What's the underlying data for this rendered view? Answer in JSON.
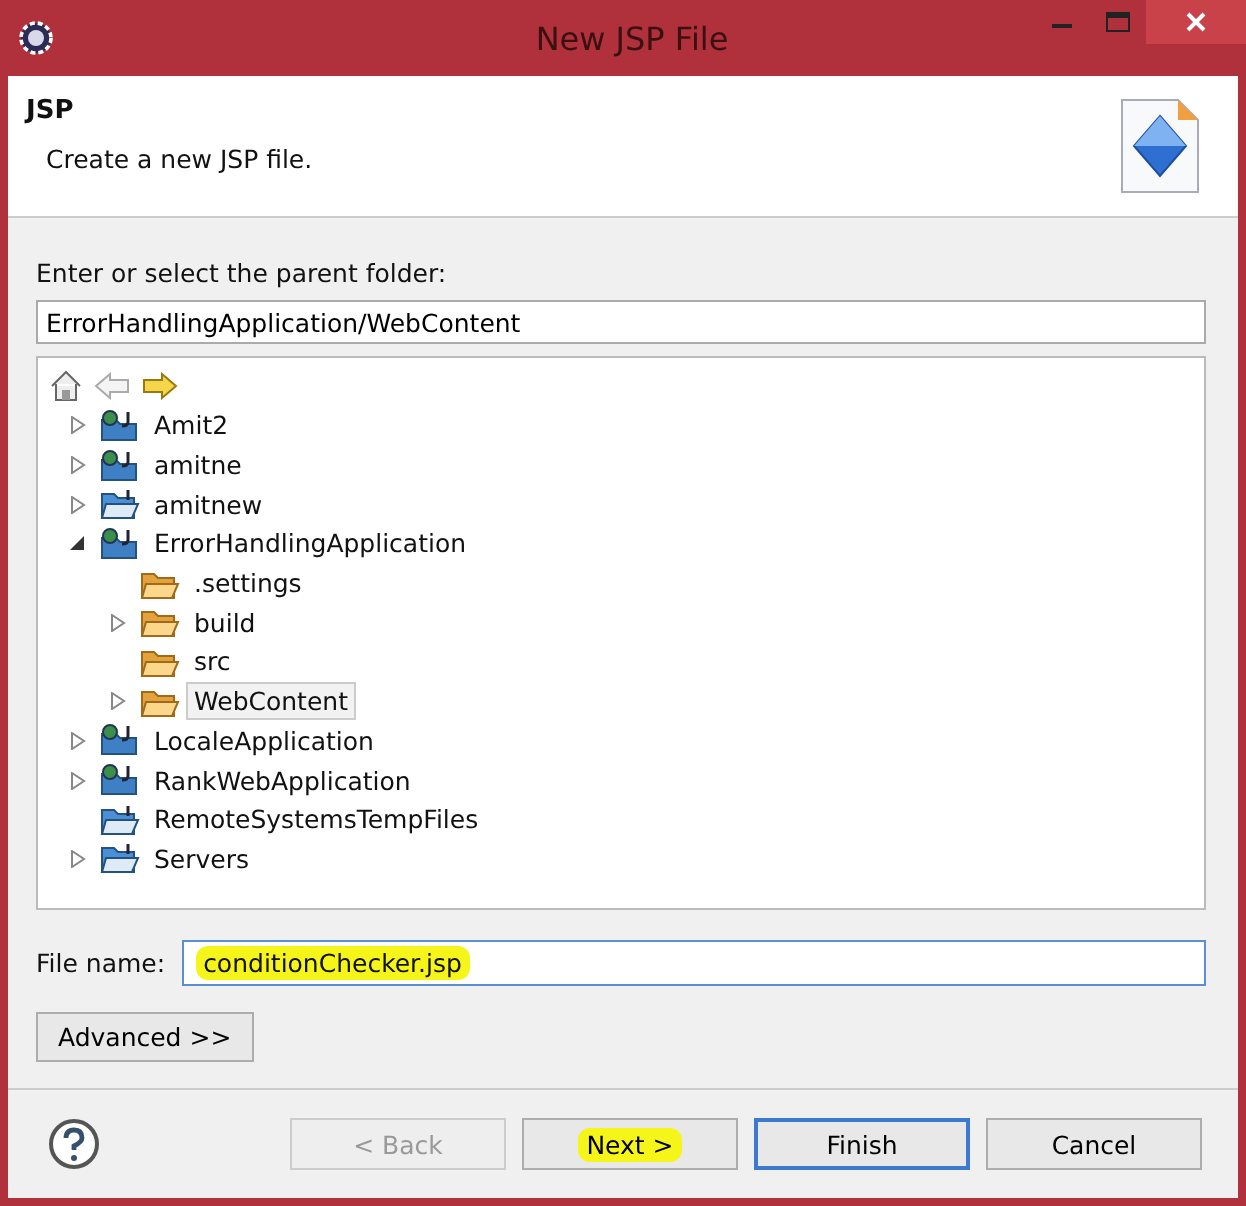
{
  "window": {
    "title": "New JSP File"
  },
  "header": {
    "title": "JSP",
    "description": "Create a new JSP file."
  },
  "parent_folder": {
    "label": "Enter or select the parent folder:",
    "value": "ErrorHandlingApplication/WebContent"
  },
  "tree": {
    "items": [
      {
        "label": "Amit2",
        "kind": "web-project",
        "expanded": false,
        "selected": false
      },
      {
        "label": "amitne",
        "kind": "web-project",
        "expanded": false,
        "selected": false
      },
      {
        "label": "amitnew",
        "kind": "project",
        "expanded": false,
        "selected": false
      },
      {
        "label": "ErrorHandlingApplication",
        "kind": "web-project",
        "expanded": true,
        "selected": false,
        "children": [
          {
            "label": ".settings",
            "kind": "folder",
            "selected": false
          },
          {
            "label": "build",
            "kind": "folder",
            "expanded": false,
            "selected": false
          },
          {
            "label": "src",
            "kind": "folder",
            "selected": false
          },
          {
            "label": "WebContent",
            "kind": "folder",
            "expanded": false,
            "selected": true
          }
        ]
      },
      {
        "label": "LocaleApplication",
        "kind": "web-project",
        "expanded": false,
        "selected": false
      },
      {
        "label": "RankWebApplication",
        "kind": "web-project",
        "expanded": false,
        "selected": false
      },
      {
        "label": "RemoteSystemsTempFiles",
        "kind": "project",
        "selected": false
      },
      {
        "label": "Servers",
        "kind": "project",
        "expanded": false,
        "selected": false
      }
    ]
  },
  "file_name": {
    "label": "File name:",
    "value": "conditionChecker.jsp",
    "highlighted": true
  },
  "advanced_button": {
    "label": "Advanced >>"
  },
  "buttons": [
    {
      "label": "< Back",
      "disabled": true,
      "highlighted": false,
      "focused": false
    },
    {
      "label": "Next >",
      "disabled": false,
      "highlighted": true,
      "focused": false
    },
    {
      "label": "Finish",
      "disabled": false,
      "highlighted": false,
      "focused": true
    },
    {
      "label": "Cancel",
      "disabled": false,
      "highlighted": false,
      "focused": false
    }
  ]
}
